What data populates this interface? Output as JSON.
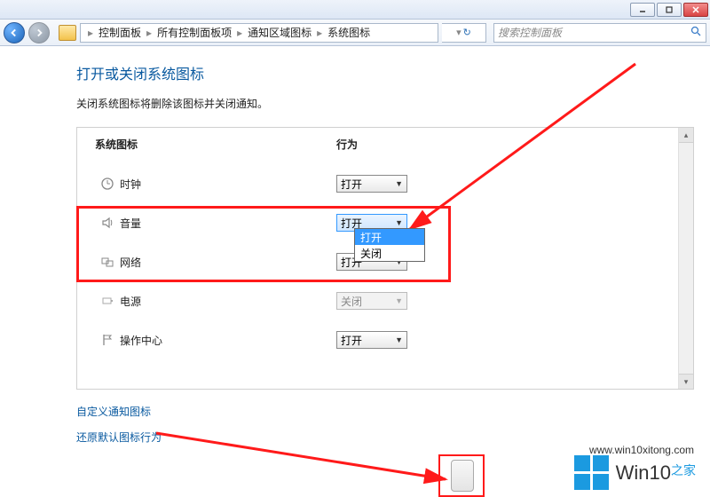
{
  "window": {
    "minimize_title": "Minimize",
    "maximize_title": "Maximize",
    "close_title": "Close"
  },
  "nav": {
    "back_title": "Back",
    "forward_title": "Forward",
    "crumbs": [
      "控制面板",
      "所有控制面板项",
      "通知区域图标",
      "系统图标"
    ],
    "refresh_label": "↻",
    "search_placeholder": "搜索控制面板"
  },
  "page": {
    "title": "打开或关闭系统图标",
    "subtitle": "关闭系统图标将删除该图标并关闭通知。"
  },
  "table": {
    "header_icon": "系统图标",
    "header_behavior": "行为",
    "rows": [
      {
        "icon": "clock",
        "label": "时钟",
        "value": "打开",
        "disabled": false
      },
      {
        "icon": "volume",
        "label": "音量",
        "value": "打开",
        "disabled": false,
        "open": true
      },
      {
        "icon": "network",
        "label": "网络",
        "value": "打开",
        "disabled": false
      },
      {
        "icon": "power",
        "label": "电源",
        "value": "关闭",
        "disabled": true
      },
      {
        "icon": "flag",
        "label": "操作中心",
        "value": "打开",
        "disabled": false
      }
    ],
    "dropdown_options": [
      "打开",
      "关闭"
    ],
    "dropdown_selected": "打开"
  },
  "links": {
    "customize": "自定义通知图标",
    "restore": "还原默认图标行为"
  },
  "watermark": {
    "text_main": "Win10",
    "text_sub": "之家",
    "url": "www.win10xitong.com"
  },
  "help_label": "?"
}
